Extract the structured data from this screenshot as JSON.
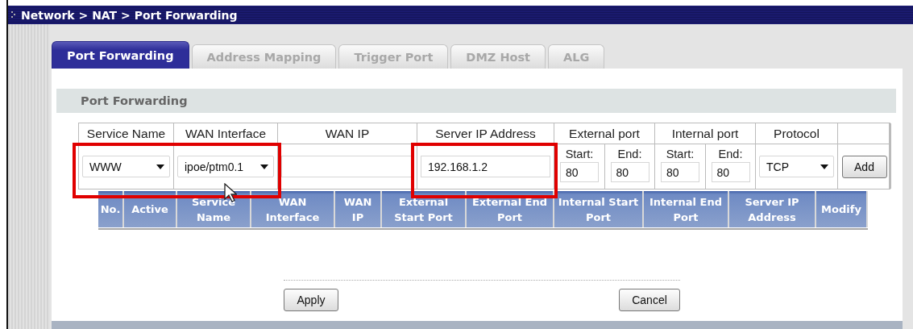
{
  "breadcrumb": "Network > NAT > Port Forwarding",
  "tabs": [
    {
      "label": "Port Forwarding",
      "selected": true
    },
    {
      "label": "Address Mapping",
      "selected": false
    },
    {
      "label": "Trigger Port",
      "selected": false
    },
    {
      "label": "DMZ Host",
      "selected": false
    },
    {
      "label": "ALG",
      "selected": false
    }
  ],
  "section_title": "Port Forwarding",
  "form": {
    "columns": [
      {
        "header": "Service Name",
        "fields": [
          {
            "kind": "select",
            "value": "WWW",
            "highlighted": true
          }
        ]
      },
      {
        "header": "WAN Interface",
        "fields": [
          {
            "kind": "select",
            "value": "ipoe/ptm0.1",
            "highlighted": true
          }
        ]
      },
      {
        "header": "WAN IP",
        "fields": [
          {
            "kind": "text",
            "highlighted": false
          }
        ]
      },
      {
        "header": "Server IP Address",
        "fields": [
          {
            "kind": "text",
            "value": "192.168.1.2",
            "highlighted": true
          }
        ]
      },
      {
        "header": "External port",
        "fields": [
          {
            "kind": "port",
            "label": "Start:",
            "value": "80",
            "highlighted": false
          },
          {
            "kind": "port",
            "label": "End:",
            "value": "80",
            "highlighted": false
          }
        ]
      },
      {
        "header": "Internal port",
        "fields": [
          {
            "kind": "port",
            "label": "Start:",
            "value": "80",
            "highlighted": false
          },
          {
            "kind": "port",
            "label": "End:",
            "value": "80",
            "highlighted": false
          }
        ]
      },
      {
        "header": "Protocol",
        "fields": [
          {
            "kind": "select",
            "value": "TCP",
            "highlighted": false
          }
        ]
      },
      {
        "fields": [
          {
            "kind": "button",
            "value": "Add",
            "highlighted": false
          }
        ]
      }
    ]
  },
  "table": {
    "columns": [
      "No.",
      "Active",
      "Service Name",
      "WAN Interface",
      "WAN IP",
      "External Start Port",
      "External End Port",
      "Internal Start Port",
      "Internal End Port",
      "Server IP Address",
      "Modify"
    ]
  },
  "buttons": [
    "Apply",
    "Cancel"
  ]
}
